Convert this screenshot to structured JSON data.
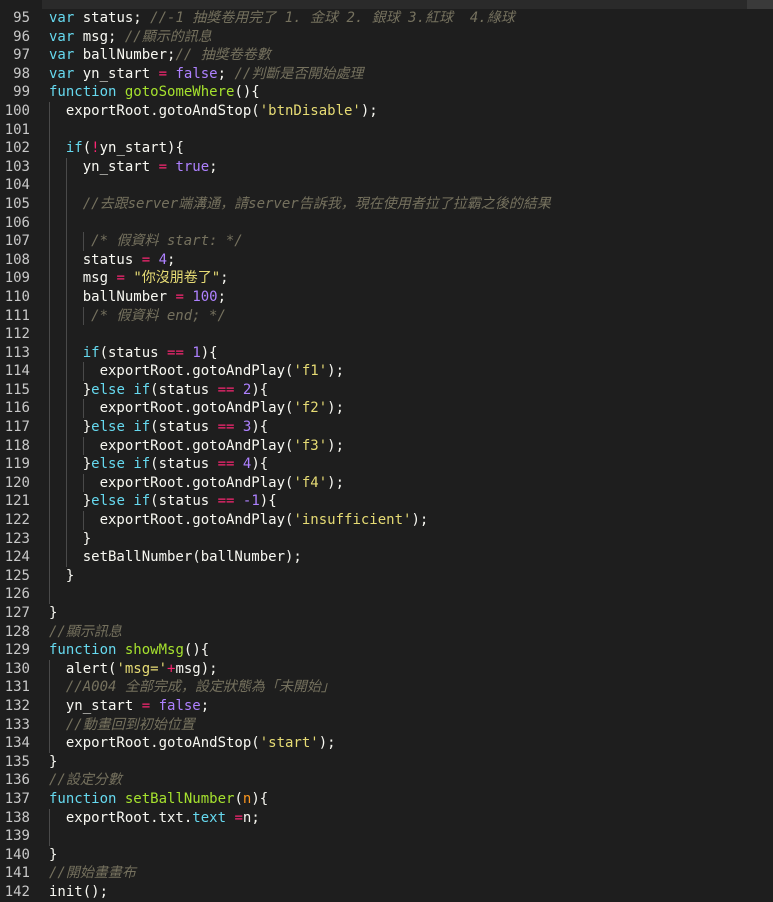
{
  "colors": {
    "background": "#1e1e1e",
    "keyword": "#66d9ef",
    "function_name": "#a6e22e",
    "string": "#e6db74",
    "number": "#ae81ff",
    "comment": "#75715e",
    "operator": "#f92672",
    "line_number": "#c8c8c8"
  },
  "lines": [
    {
      "n": "95",
      "guides": 0,
      "tokens": [
        {
          "t": "var",
          "c": "kw"
        },
        {
          "t": " status; "
        },
        {
          "t": "//-1 抽獎卷用完了 1. 金球 2. 銀球 3.紅球  4.綠球",
          "c": "cm"
        }
      ]
    },
    {
      "n": "96",
      "guides": 0,
      "tokens": [
        {
          "t": "var",
          "c": "kw"
        },
        {
          "t": " msg; "
        },
        {
          "t": "//顯示的訊息",
          "c": "cm"
        }
      ]
    },
    {
      "n": "97",
      "guides": 0,
      "tokens": [
        {
          "t": "var",
          "c": "kw"
        },
        {
          "t": " ballNumber;"
        },
        {
          "t": "// 抽獎卷卷數",
          "c": "cm"
        }
      ]
    },
    {
      "n": "98",
      "guides": 0,
      "tokens": [
        {
          "t": "var",
          "c": "kw"
        },
        {
          "t": " yn_start "
        },
        {
          "t": "=",
          "c": "op"
        },
        {
          "t": " "
        },
        {
          "t": "false",
          "c": "num"
        },
        {
          "t": "; "
        },
        {
          "t": "//判斷是否開始處理",
          "c": "cm"
        }
      ]
    },
    {
      "n": "99",
      "guides": 0,
      "tokens": [
        {
          "t": "function",
          "c": "kw"
        },
        {
          "t": " "
        },
        {
          "t": "gotoSomeWhere",
          "c": "fn"
        },
        {
          "t": "(){"
        }
      ]
    },
    {
      "n": "100",
      "guides": 1,
      "tokens": [
        {
          "t": "  exportRoot.gotoAndStop("
        },
        {
          "t": "'btnDisable'",
          "c": "str"
        },
        {
          "t": ");"
        }
      ]
    },
    {
      "n": "101",
      "guides": 1,
      "tokens": []
    },
    {
      "n": "102",
      "guides": 1,
      "tokens": [
        {
          "t": "  "
        },
        {
          "t": "if",
          "c": "kw"
        },
        {
          "t": "("
        },
        {
          "t": "!",
          "c": "op"
        },
        {
          "t": "yn_start){"
        }
      ]
    },
    {
      "n": "103",
      "guides": 2,
      "tokens": [
        {
          "t": "    yn_start "
        },
        {
          "t": "=",
          "c": "op"
        },
        {
          "t": " "
        },
        {
          "t": "true",
          "c": "num"
        },
        {
          "t": ";"
        }
      ]
    },
    {
      "n": "104",
      "guides": 2,
      "tokens": []
    },
    {
      "n": "105",
      "guides": 2,
      "tokens": [
        {
          "t": "    "
        },
        {
          "t": "//去跟server端溝通，請server告訴我，現在使用者拉了拉霸之後的結果",
          "c": "cm"
        }
      ]
    },
    {
      "n": "106",
      "guides": 2,
      "tokens": []
    },
    {
      "n": "107",
      "guides": 3,
      "tokens": [
        {
          "t": "     "
        },
        {
          "t": "/* 假資料 start: */",
          "c": "cm"
        }
      ]
    },
    {
      "n": "108",
      "guides": 2,
      "tokens": [
        {
          "t": "    status "
        },
        {
          "t": "=",
          "c": "op"
        },
        {
          "t": " "
        },
        {
          "t": "4",
          "c": "num"
        },
        {
          "t": ";"
        }
      ]
    },
    {
      "n": "109",
      "guides": 2,
      "tokens": [
        {
          "t": "    msg "
        },
        {
          "t": "=",
          "c": "op"
        },
        {
          "t": " "
        },
        {
          "t": "\"你沒朋卷了\"",
          "c": "str"
        },
        {
          "t": ";"
        }
      ]
    },
    {
      "n": "110",
      "guides": 2,
      "tokens": [
        {
          "t": "    ballNumber "
        },
        {
          "t": "=",
          "c": "op"
        },
        {
          "t": " "
        },
        {
          "t": "100",
          "c": "num"
        },
        {
          "t": ";"
        }
      ]
    },
    {
      "n": "111",
      "guides": 3,
      "tokens": [
        {
          "t": "     "
        },
        {
          "t": "/* 假資料 end; */",
          "c": "cm"
        }
      ]
    },
    {
      "n": "112",
      "guides": 2,
      "tokens": []
    },
    {
      "n": "113",
      "guides": 2,
      "tokens": [
        {
          "t": "    "
        },
        {
          "t": "if",
          "c": "kw"
        },
        {
          "t": "(status "
        },
        {
          "t": "==",
          "c": "op"
        },
        {
          "t": " "
        },
        {
          "t": "1",
          "c": "num"
        },
        {
          "t": "){"
        }
      ]
    },
    {
      "n": "114",
      "guides": 3,
      "tokens": [
        {
          "t": "      exportRoot.gotoAndPlay("
        },
        {
          "t": "'f1'",
          "c": "str"
        },
        {
          "t": ");"
        }
      ]
    },
    {
      "n": "115",
      "guides": 2,
      "tokens": [
        {
          "t": "    }"
        },
        {
          "t": "else",
          "c": "kw"
        },
        {
          "t": " "
        },
        {
          "t": "if",
          "c": "kw"
        },
        {
          "t": "(status "
        },
        {
          "t": "==",
          "c": "op"
        },
        {
          "t": " "
        },
        {
          "t": "2",
          "c": "num"
        },
        {
          "t": "){"
        }
      ]
    },
    {
      "n": "116",
      "guides": 3,
      "tokens": [
        {
          "t": "      exportRoot.gotoAndPlay("
        },
        {
          "t": "'f2'",
          "c": "str"
        },
        {
          "t": ");"
        }
      ]
    },
    {
      "n": "117",
      "guides": 2,
      "tokens": [
        {
          "t": "    }"
        },
        {
          "t": "else",
          "c": "kw"
        },
        {
          "t": " "
        },
        {
          "t": "if",
          "c": "kw"
        },
        {
          "t": "(status "
        },
        {
          "t": "==",
          "c": "op"
        },
        {
          "t": " "
        },
        {
          "t": "3",
          "c": "num"
        },
        {
          "t": "){"
        }
      ]
    },
    {
      "n": "118",
      "guides": 3,
      "tokens": [
        {
          "t": "      exportRoot.gotoAndPlay("
        },
        {
          "t": "'f3'",
          "c": "str"
        },
        {
          "t": ");"
        }
      ]
    },
    {
      "n": "119",
      "guides": 2,
      "tokens": [
        {
          "t": "    }"
        },
        {
          "t": "else",
          "c": "kw"
        },
        {
          "t": " "
        },
        {
          "t": "if",
          "c": "kw"
        },
        {
          "t": "(status "
        },
        {
          "t": "==",
          "c": "op"
        },
        {
          "t": " "
        },
        {
          "t": "4",
          "c": "num"
        },
        {
          "t": "){"
        }
      ]
    },
    {
      "n": "120",
      "guides": 3,
      "tokens": [
        {
          "t": "      exportRoot.gotoAndPlay("
        },
        {
          "t": "'f4'",
          "c": "str"
        },
        {
          "t": ");"
        }
      ]
    },
    {
      "n": "121",
      "guides": 2,
      "tokens": [
        {
          "t": "    }"
        },
        {
          "t": "else",
          "c": "kw"
        },
        {
          "t": " "
        },
        {
          "t": "if",
          "c": "kw"
        },
        {
          "t": "(status "
        },
        {
          "t": "==",
          "c": "op"
        },
        {
          "t": " "
        },
        {
          "t": "-1",
          "c": "num"
        },
        {
          "t": "){"
        }
      ]
    },
    {
      "n": "122",
      "guides": 3,
      "tokens": [
        {
          "t": "      exportRoot.gotoAndPlay("
        },
        {
          "t": "'insufficient'",
          "c": "str"
        },
        {
          "t": ");"
        }
      ]
    },
    {
      "n": "123",
      "guides": 2,
      "tokens": [
        {
          "t": "    }"
        }
      ]
    },
    {
      "n": "124",
      "guides": 2,
      "tokens": [
        {
          "t": "    setBallNumber(ballNumber);"
        }
      ]
    },
    {
      "n": "125",
      "guides": 1,
      "tokens": [
        {
          "t": "  }"
        }
      ]
    },
    {
      "n": "126",
      "guides": 1,
      "tokens": []
    },
    {
      "n": "127",
      "guides": 0,
      "tokens": [
        {
          "t": "}"
        }
      ]
    },
    {
      "n": "128",
      "guides": 0,
      "tokens": [
        {
          "t": "//顯示訊息",
          "c": "cm"
        }
      ]
    },
    {
      "n": "129",
      "guides": 0,
      "tokens": [
        {
          "t": "function",
          "c": "kw"
        },
        {
          "t": " "
        },
        {
          "t": "showMsg",
          "c": "fn"
        },
        {
          "t": "(){"
        }
      ]
    },
    {
      "n": "130",
      "guides": 1,
      "tokens": [
        {
          "t": "  alert("
        },
        {
          "t": "'msg='",
          "c": "str"
        },
        {
          "t": "+",
          "c": "op"
        },
        {
          "t": "msg);"
        }
      ]
    },
    {
      "n": "131",
      "guides": 1,
      "tokens": [
        {
          "t": "  "
        },
        {
          "t": "//A004 全部完成，設定狀態為「未開始」",
          "c": "cm"
        }
      ]
    },
    {
      "n": "132",
      "guides": 1,
      "tokens": [
        {
          "t": "  yn_start "
        },
        {
          "t": "=",
          "c": "op"
        },
        {
          "t": " "
        },
        {
          "t": "false",
          "c": "num"
        },
        {
          "t": ";"
        }
      ]
    },
    {
      "n": "133",
      "guides": 1,
      "tokens": [
        {
          "t": "  "
        },
        {
          "t": "//動畫回到初始位置",
          "c": "cm"
        }
      ]
    },
    {
      "n": "134",
      "guides": 1,
      "tokens": [
        {
          "t": "  exportRoot.gotoAndStop("
        },
        {
          "t": "'start'",
          "c": "str"
        },
        {
          "t": ");"
        }
      ]
    },
    {
      "n": "135",
      "guides": 0,
      "tokens": [
        {
          "t": "}"
        }
      ]
    },
    {
      "n": "136",
      "guides": 0,
      "tokens": [
        {
          "t": "//設定分數",
          "c": "cm"
        }
      ]
    },
    {
      "n": "137",
      "guides": 0,
      "tokens": [
        {
          "t": "function",
          "c": "kw"
        },
        {
          "t": " "
        },
        {
          "t": "setBallNumber",
          "c": "fn"
        },
        {
          "t": "("
        },
        {
          "t": "n",
          "c": "lit"
        },
        {
          "t": "){"
        }
      ]
    },
    {
      "n": "138",
      "guides": 1,
      "tokens": [
        {
          "t": "  exportRoot.txt."
        },
        {
          "t": "text",
          "c": "kw"
        },
        {
          "t": " "
        },
        {
          "t": "=",
          "c": "op"
        },
        {
          "t": "n;"
        }
      ]
    },
    {
      "n": "139",
      "guides": 1,
      "tokens": []
    },
    {
      "n": "140",
      "guides": 0,
      "tokens": [
        {
          "t": "}"
        }
      ]
    },
    {
      "n": "141",
      "guides": 0,
      "tokens": [
        {
          "t": "//開始畫畫布",
          "c": "cm"
        }
      ]
    },
    {
      "n": "142",
      "guides": 0,
      "tokens": [
        {
          "t": "init();"
        }
      ]
    }
  ]
}
